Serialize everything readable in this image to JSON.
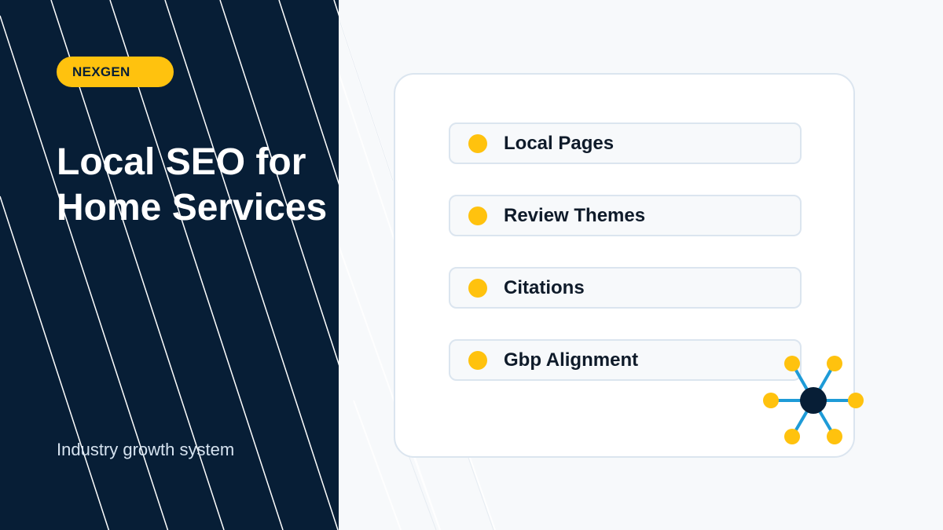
{
  "brand": {
    "name": "NEXGEN"
  },
  "hero": {
    "title": "Local SEO for Home Services",
    "subtitle": "Industry growth system"
  },
  "features": [
    {
      "label": "Local Pages"
    },
    {
      "label": "Review Themes"
    },
    {
      "label": "Citations"
    },
    {
      "label": "Gbp Alignment"
    }
  ],
  "colors": {
    "navy": "#071e36",
    "accent_yellow": "#ffc20e",
    "connector_blue": "#1e9bd7",
    "card_border": "#dbe5ef",
    "page_background": "#f7f9fb"
  },
  "icons": {
    "network": "network-hub-icon"
  }
}
